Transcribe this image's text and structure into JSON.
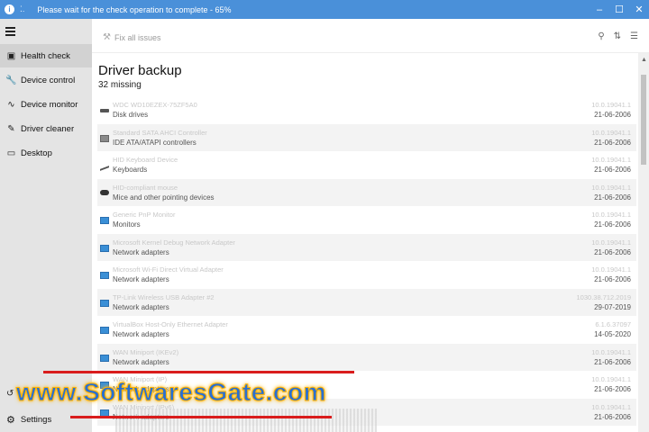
{
  "titlebar": {
    "message": "Please wait for the check operation to complete - 65%",
    "progress_percent": 65,
    "info_icon": "info-icon",
    "spinner_icon": "spinner-icon"
  },
  "sidebar": {
    "items": [
      {
        "label": "Health check",
        "icon": "health-icon",
        "active": true
      },
      {
        "label": "Device control",
        "icon": "wrench-icon",
        "active": false
      },
      {
        "label": "Device monitor",
        "icon": "pulse-icon",
        "active": false
      },
      {
        "label": "Driver cleaner",
        "icon": "broom-icon",
        "active": false
      },
      {
        "label": "Desktop",
        "icon": "monitor-icon",
        "active": false
      }
    ],
    "settings_label": "Settings"
  },
  "toolbar": {
    "fix_all_label": "Fix all issues"
  },
  "content": {
    "title": "Driver backup",
    "subtitle": "32 missing"
  },
  "drivers": [
    {
      "name": "WDC WD10EZEX-75ZF5A0",
      "category": "Disk drives",
      "version": "10.0.19041.1",
      "date": "21-06-2006",
      "icon": "disk-icon"
    },
    {
      "name": "Standard SATA AHCI Controller",
      "category": "IDE ATA/ATAPI controllers",
      "version": "10.0.19041.1",
      "date": "21-06-2006",
      "icon": "controller-icon"
    },
    {
      "name": "HID Keyboard Device",
      "category": "Keyboards",
      "version": "10.0.19041.1",
      "date": "21-06-2006",
      "icon": "keyboard-icon"
    },
    {
      "name": "HID-compliant mouse",
      "category": "Mice and other pointing devices",
      "version": "10.0.19041.1",
      "date": "21-06-2006",
      "icon": "mouse-icon"
    },
    {
      "name": "Generic PnP Monitor",
      "category": "Monitors",
      "version": "10.0.19041.1",
      "date": "21-06-2006",
      "icon": "monitor-icon"
    },
    {
      "name": "Microsoft Kernel Debug Network Adapter",
      "category": "Network adapters",
      "version": "10.0.19041.1",
      "date": "21-06-2006",
      "icon": "network-icon"
    },
    {
      "name": "Microsoft Wi-Fi Direct Virtual Adapter",
      "category": "Network adapters",
      "version": "10.0.19041.1",
      "date": "21-06-2006",
      "icon": "network-icon"
    },
    {
      "name": "TP-Link Wireless USB Adapter #2",
      "category": "Network adapters",
      "version": "1030.38.712.2019",
      "date": "29-07-2019",
      "icon": "network-icon"
    },
    {
      "name": "VirtualBox Host-Only Ethernet Adapter",
      "category": "Network adapters",
      "version": "6.1.6.37097",
      "date": "14-05-2020",
      "icon": "network-icon"
    },
    {
      "name": "WAN Miniport (IKEv2)",
      "category": "Network adapters",
      "version": "10.0.19041.1",
      "date": "21-06-2006",
      "icon": "network-icon"
    },
    {
      "name": "WAN Miniport (IP)",
      "category": "Network adapters",
      "version": "10.0.19041.1",
      "date": "21-06-2006",
      "icon": "network-icon"
    },
    {
      "name": "WAN Miniport (IPv6)",
      "category": "Network adapters",
      "version": "10.0.19041.1",
      "date": "21-06-2006",
      "icon": "network-icon"
    }
  ],
  "watermark": {
    "text": "www.SoftwaresGate.com"
  }
}
